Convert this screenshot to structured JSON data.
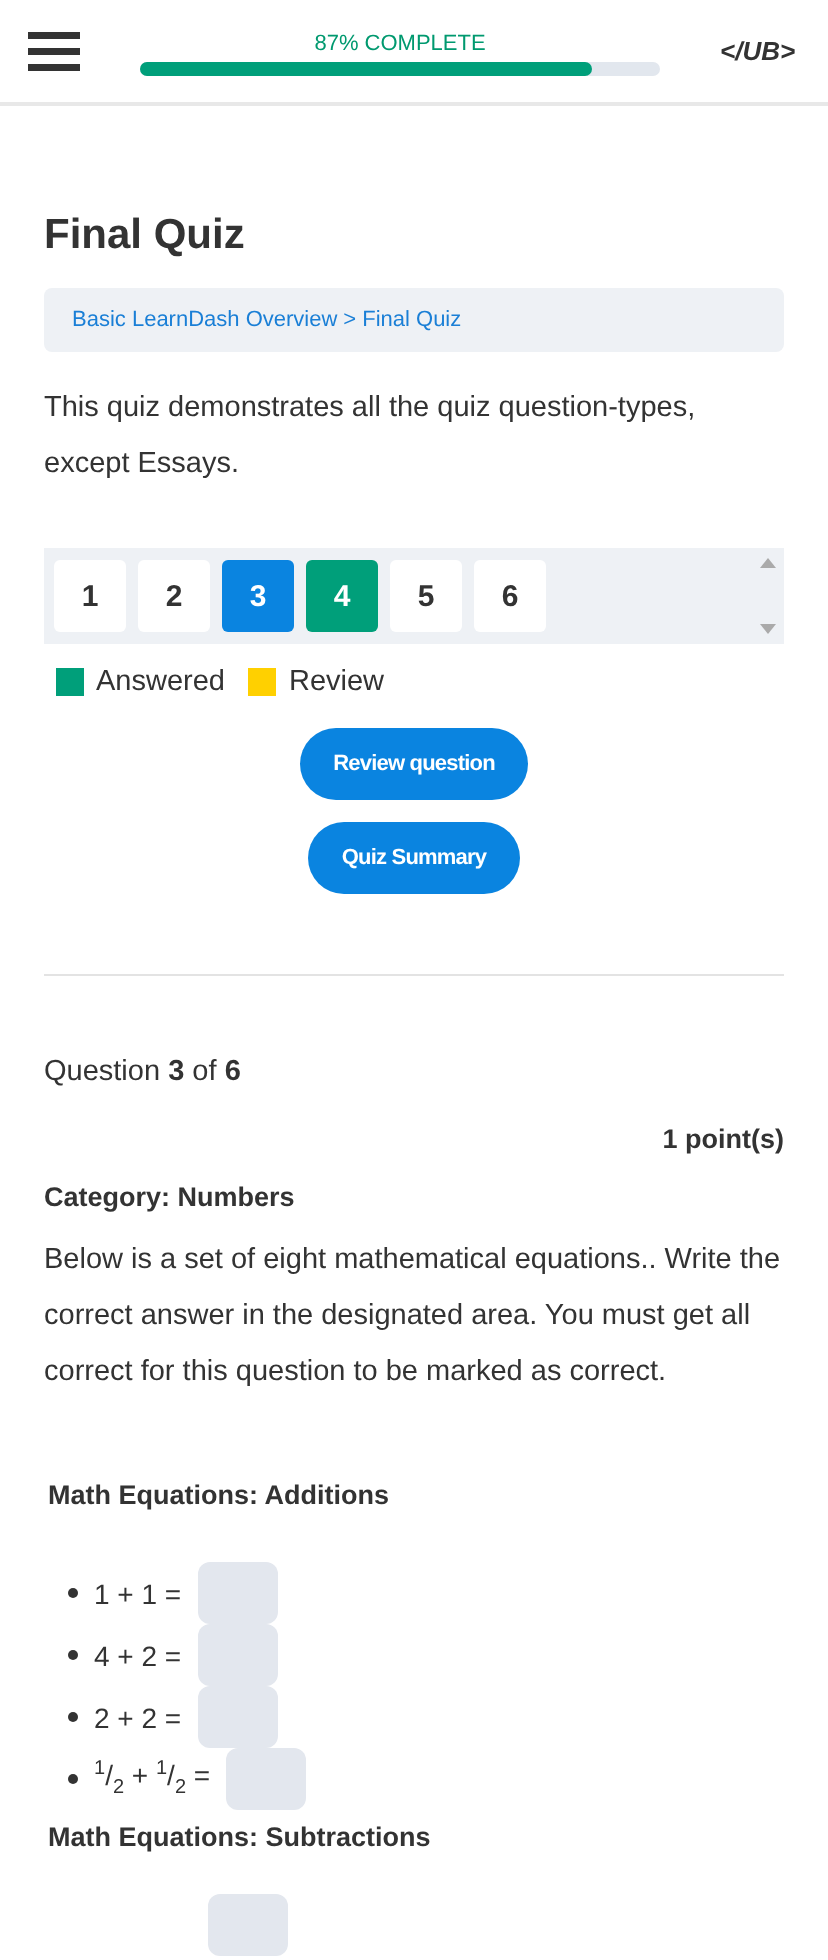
{
  "header": {
    "progress": {
      "label": "87% COMPLETE",
      "level": 0.87
    },
    "logo": "</UB>"
  },
  "title": "Final Quiz",
  "breadcrumb": [
    {
      "label": "Basic LearnDash Overview"
    },
    {
      "label": "Final Quiz"
    }
  ],
  "breadcrumb_separator": ">",
  "description": "This quiz demonstrates all the quiz question-types, except Essays.",
  "question_nav": [
    {
      "label": "1",
      "selected": false,
      "answered": false
    },
    {
      "label": "2",
      "selected": false,
      "answered": false
    },
    {
      "label": "3",
      "selected": true,
      "answered": false
    },
    {
      "label": "4",
      "selected": false,
      "answered": true
    },
    {
      "label": "5",
      "selected": false,
      "answered": false
    },
    {
      "label": "6",
      "selected": false,
      "answered": false
    }
  ],
  "legend": [
    {
      "label": "Answered",
      "color": "#009f7a"
    },
    {
      "label": "Review",
      "color": "#ffd000"
    }
  ],
  "buttons": [
    "Review question",
    "Quiz Summary"
  ],
  "question_counter": "Question **3** of **6**",
  "points": "1 point(s)",
  "category": "Category: Numbers",
  "instructions": "Below is a set of eight mathematical equations.. Write the correct answer in the designated area. You must get all correct for this question to be marked as correct.",
  "sections": [
    {
      "heading": "Math Equations: Additions",
      "items": [
        {
          "kind": "bullet",
          "text": "1 + 1 ="
        },
        {
          "kind": "bullet",
          "text": "4 + 2 ="
        },
        {
          "kind": "bullet",
          "text": "2 + 2 ="
        },
        {
          "kind": "bullet",
          "text": "$^{1}$/$_{2}$ + $^{1}$/$_{2}$ ="
        }
      ]
    },
    {
      "heading": "Math Equations: Subtractions",
      "items": [
        {
          "kind": "field_only"
        }
      ]
    }
  ]
}
